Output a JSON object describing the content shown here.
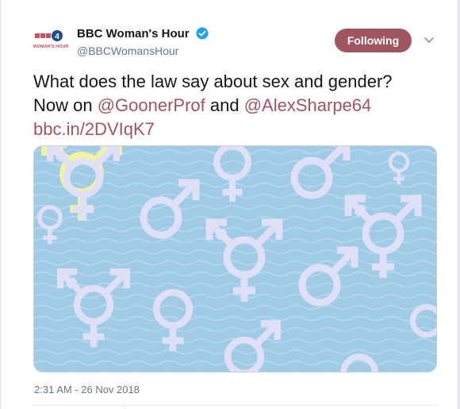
{
  "tweet": {
    "author": {
      "display_name": "BBC Woman's Hour",
      "handle": "@BBCWomansHour",
      "verified": true,
      "avatar_text": "WOMAN'S HOUR",
      "avatar_channel": "4",
      "icons": {
        "verified": "verified-badge-icon",
        "caret": "chevron-down-icon"
      }
    },
    "follow_button_label": "Following",
    "text": {
      "line1": "What does the law say about sex and gender?",
      "line2_prefix": "Now on ",
      "mention1": "@GoonerProf",
      "joiner": " and ",
      "mention2": "@AlexSharpe64",
      "link": "bbc.in/2DVIqK7"
    },
    "media": {
      "description_icon": "gender-symbols-pattern-image"
    },
    "timestamp": "2:31 AM - 26 Nov 2018"
  },
  "colors": {
    "accent": "#a05561",
    "verified": "#1da1f2",
    "media_bg": "#9fcbe6",
    "symbol": "#dfe0f7",
    "symbol_outline": "#f4f29a"
  }
}
